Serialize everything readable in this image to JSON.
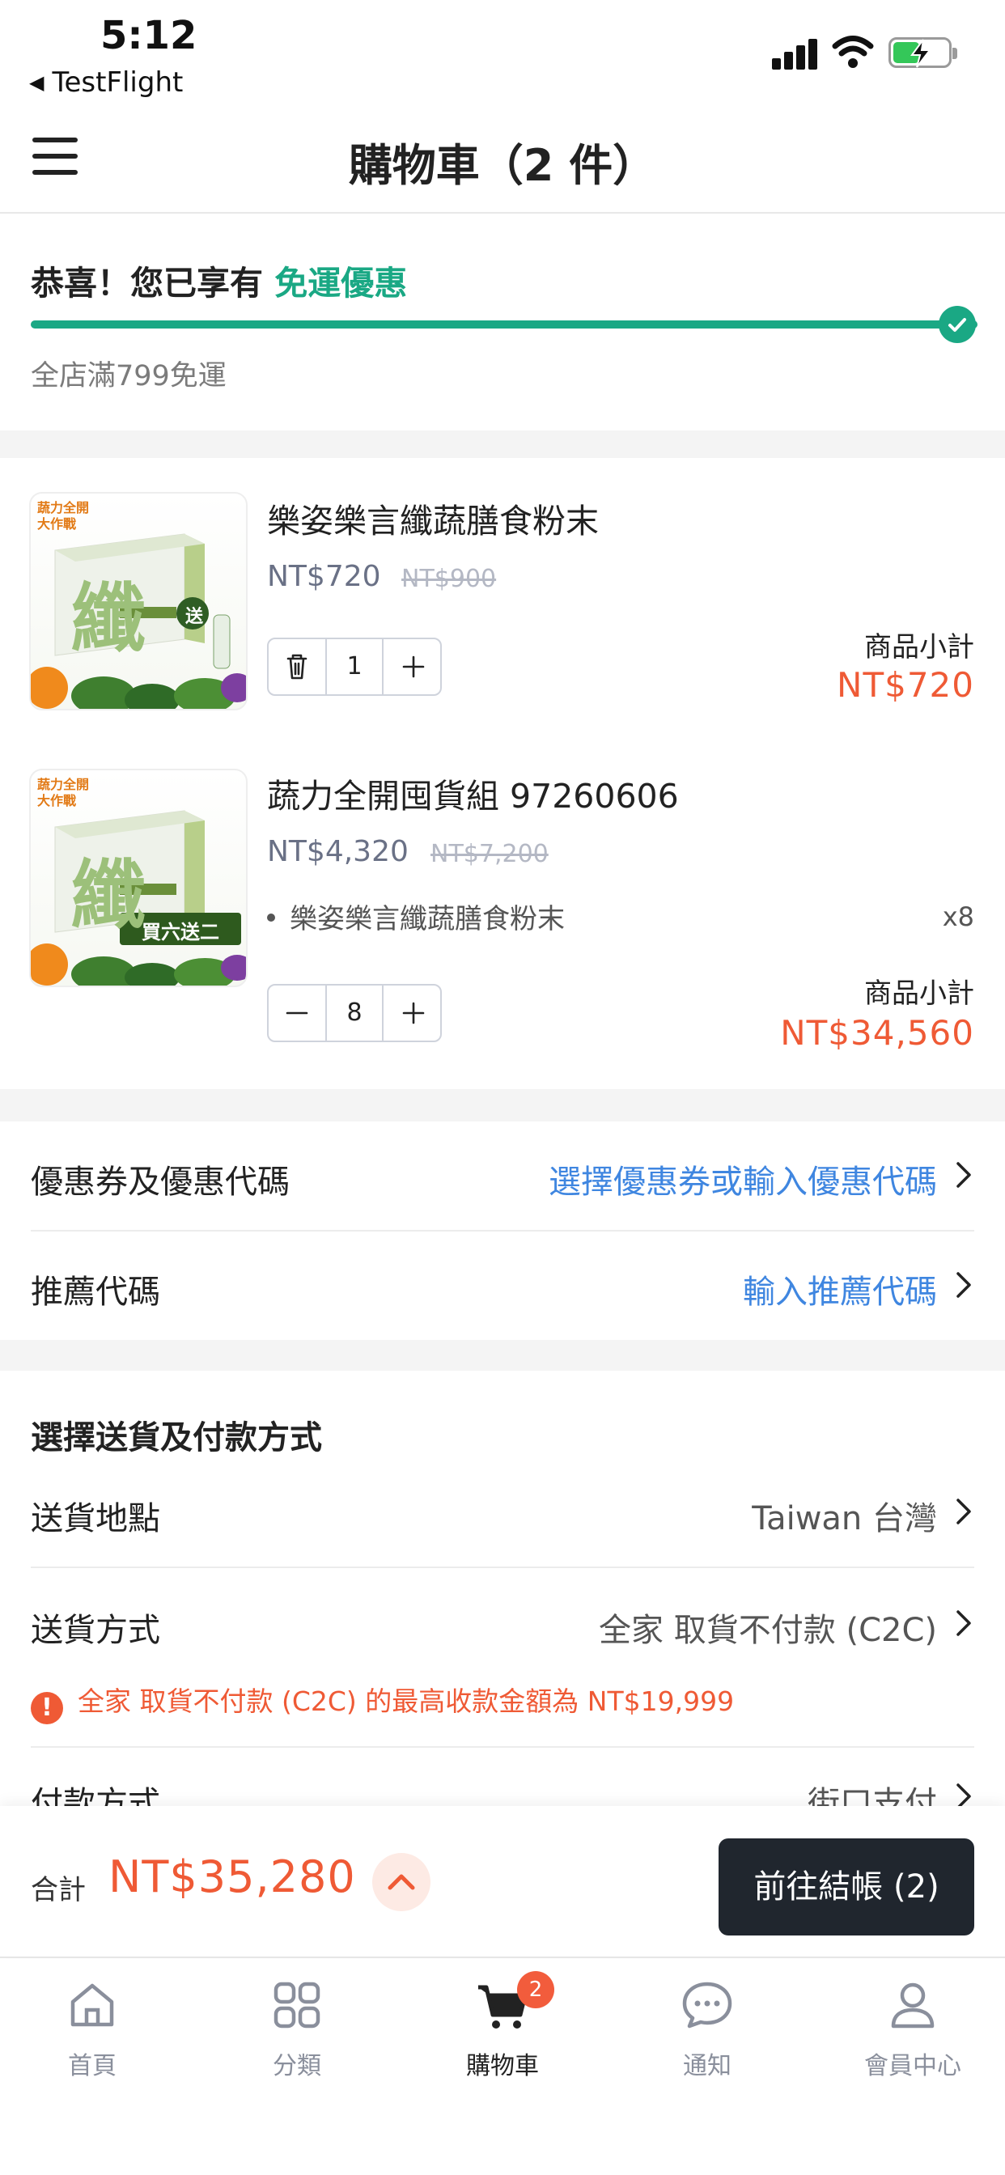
{
  "status_bar": {
    "time": "5:12",
    "back_label": "TestFlight"
  },
  "header": {
    "title": "購物車（2 件）"
  },
  "shipping": {
    "title_prefix": "恭喜！您已享有 ",
    "title_highlight": "免運優惠",
    "progress_percent": 100,
    "note": "全店滿799免運"
  },
  "cart": {
    "items": [
      {
        "name": "樂姿樂言纖蔬膳食粉末",
        "price": "NT$720",
        "original_price": "NT$900",
        "quantity": "1",
        "subtotal_label": "商品小計",
        "subtotal": "NT$720",
        "image_badge": "送",
        "image_brand": "蔬力全開大作戰",
        "box_char": "纖"
      },
      {
        "name": "蔬力全開囤貨組 97260606",
        "price": "NT$4,320",
        "original_price": "NT$7,200",
        "bundle_item": "樂姿樂言纖蔬膳食粉末",
        "bundle_qty": "x8",
        "quantity": "8",
        "subtotal_label": "商品小計",
        "subtotal": "NT$34,560",
        "image_badge": "買六送二",
        "image_brand": "蔬力全開大作戰",
        "box_char": "纖"
      }
    ]
  },
  "promo": {
    "coupon_label": "優惠券及優惠代碼",
    "coupon_action": "選擇優惠券或輸入優惠代碼",
    "referral_label": "推薦代碼",
    "referral_action": "輸入推薦代碼"
  },
  "delivery": {
    "section_title": "選擇送貨及付款方式",
    "location_label": "送貨地點",
    "location_value": "Taiwan 台灣",
    "method_label": "送貨方式",
    "method_value": "全家 取貨不付款 (C2C)",
    "warning": "全家 取貨不付款 (C2C) 的最高收款金額為 NT$19,999",
    "payment_label": "付款方式",
    "payment_value": "街口支付"
  },
  "checkout": {
    "total_label": "合計",
    "total_value": "NT$35,280",
    "button_label": "前往結帳 (2)"
  },
  "tabs": [
    {
      "label": "首頁",
      "icon": "home-icon"
    },
    {
      "label": "分類",
      "icon": "category-icon"
    },
    {
      "label": "購物車",
      "icon": "cart-icon",
      "badge": "2",
      "active": true
    },
    {
      "label": "通知",
      "icon": "chat-bubble-icon"
    },
    {
      "label": "會員中心",
      "icon": "user-icon"
    }
  ],
  "colors": {
    "accent_green": "#1aa884",
    "price_red": "#ef5a35",
    "link_blue": "#3f86e0",
    "dark_button": "#20262e"
  }
}
